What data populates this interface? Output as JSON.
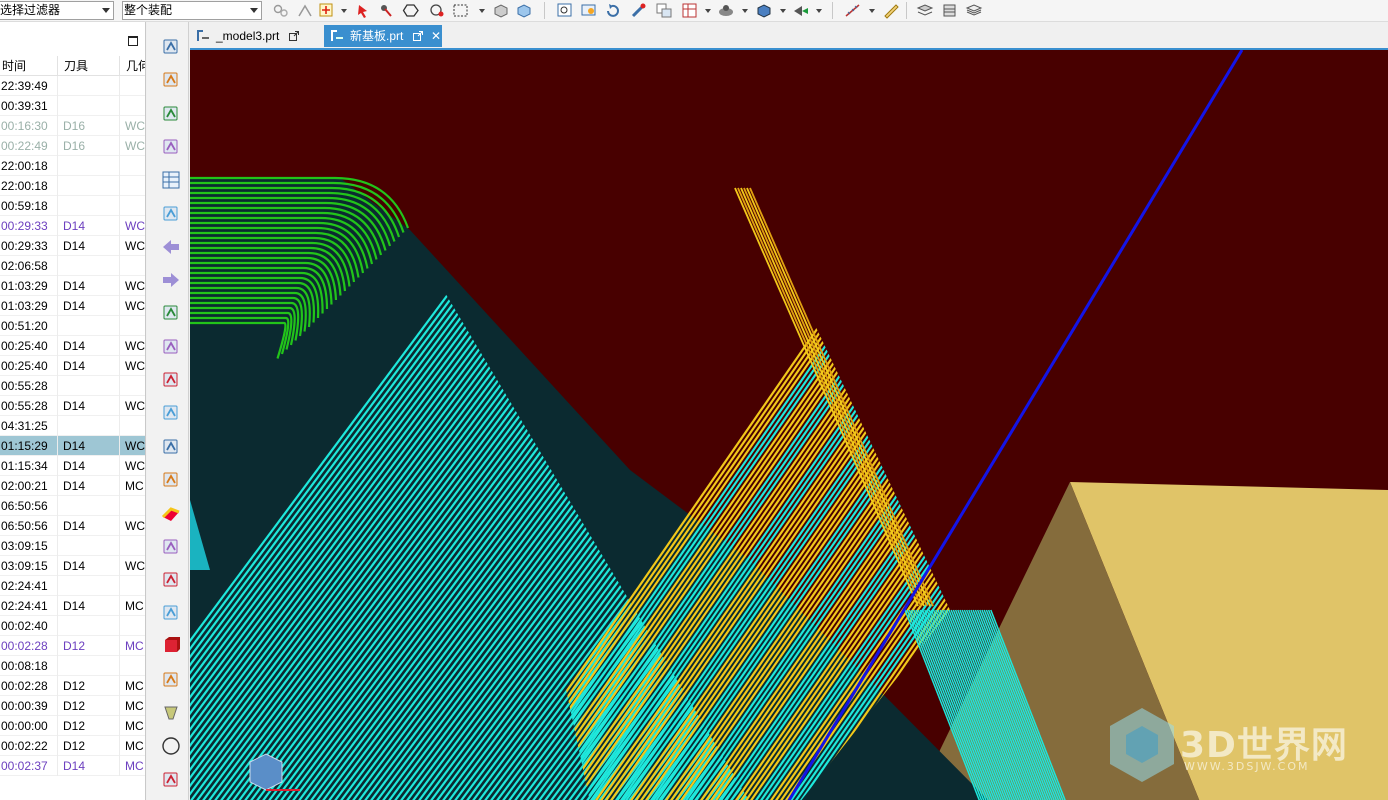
{
  "toolbar": {
    "selection_filter": "选择过滤器",
    "scope": "整个装配"
  },
  "navigator": {
    "columns": [
      "时间",
      "刀具",
      "几何"
    ],
    "rows": [
      {
        "time": "22:39:49",
        "tool": "",
        "geom": "",
        "style": ""
      },
      {
        "time": "00:39:31",
        "tool": "",
        "geom": "",
        "style": ""
      },
      {
        "time": "00:16:30",
        "tool": "D16",
        "geom": "WC",
        "style": "faded"
      },
      {
        "time": "00:22:49",
        "tool": "D16",
        "geom": "WC",
        "style": "faded"
      },
      {
        "time": "22:00:18",
        "tool": "",
        "geom": "",
        "style": ""
      },
      {
        "time": "22:00:18",
        "tool": "",
        "geom": "",
        "style": ""
      },
      {
        "time": "00:59:18",
        "tool": "",
        "geom": "",
        "style": ""
      },
      {
        "time": "00:29:33",
        "tool": "D14",
        "geom": "WC",
        "style": "purple"
      },
      {
        "time": "00:29:33",
        "tool": "D14",
        "geom": "WC",
        "style": ""
      },
      {
        "time": "02:06:58",
        "tool": "",
        "geom": "",
        "style": ""
      },
      {
        "time": "01:03:29",
        "tool": "D14",
        "geom": "WC",
        "style": ""
      },
      {
        "time": "01:03:29",
        "tool": "D14",
        "geom": "WC",
        "style": ""
      },
      {
        "time": "00:51:20",
        "tool": "",
        "geom": "",
        "style": ""
      },
      {
        "time": "00:25:40",
        "tool": "D14",
        "geom": "WC",
        "style": ""
      },
      {
        "time": "00:25:40",
        "tool": "D14",
        "geom": "WC",
        "style": ""
      },
      {
        "time": "00:55:28",
        "tool": "",
        "geom": "",
        "style": ""
      },
      {
        "time": "00:55:28",
        "tool": "D14",
        "geom": "WC",
        "style": ""
      },
      {
        "time": "04:31:25",
        "tool": "",
        "geom": "",
        "style": ""
      },
      {
        "time": "01:15:29",
        "tool": "D14",
        "geom": "WC",
        "style": "sel"
      },
      {
        "time": "01:15:34",
        "tool": "D14",
        "geom": "WC",
        "style": ""
      },
      {
        "time": "02:00:21",
        "tool": "D14",
        "geom": "MC",
        "style": ""
      },
      {
        "time": "06:50:56",
        "tool": "",
        "geom": "",
        "style": ""
      },
      {
        "time": "06:50:56",
        "tool": "D14",
        "geom": "WC",
        "style": ""
      },
      {
        "time": "03:09:15",
        "tool": "",
        "geom": "",
        "style": ""
      },
      {
        "time": "03:09:15",
        "tool": "D14",
        "geom": "WC",
        "style": ""
      },
      {
        "time": "02:24:41",
        "tool": "",
        "geom": "",
        "style": ""
      },
      {
        "time": "02:24:41",
        "tool": "D14",
        "geom": "MC",
        "style": ""
      },
      {
        "time": "00:02:40",
        "tool": "",
        "geom": "",
        "style": ""
      },
      {
        "time": "00:02:28",
        "tool": "D12",
        "geom": "MC",
        "style": "purple"
      },
      {
        "time": "00:08:18",
        "tool": "",
        "geom": "",
        "style": ""
      },
      {
        "time": "00:02:28",
        "tool": "D12",
        "geom": "MC",
        "style": ""
      },
      {
        "time": "00:00:39",
        "tool": "D12",
        "geom": "MC",
        "style": ""
      },
      {
        "time": "00:00:00",
        "tool": "D12",
        "geom": "MC",
        "style": ""
      },
      {
        "time": "00:02:22",
        "tool": "D12",
        "geom": "MC",
        "style": ""
      },
      {
        "time": "00:02:37",
        "tool": "D14",
        "geom": "MC",
        "style": "purple"
      }
    ]
  },
  "tabs": [
    {
      "label": "_model3.prt",
      "active": false
    },
    {
      "label": "新基板.prt",
      "active": true
    }
  ],
  "viewport": {
    "background": "#480000",
    "colors": {
      "finish_pass": "#22c41a",
      "cyan_pass": "#1ee8dc",
      "yellow_pass": "#f2c81a",
      "tool_axis": "#1414e6",
      "part_face": "#e0c468"
    }
  },
  "watermark": {
    "brand": "3D世界网",
    "url": "WWW.3DSJW.COM"
  },
  "icons": {
    "toolbar": [
      "filter-icon",
      "snap-icon",
      "select-icon",
      "cursor-icon",
      "node-icon",
      "hexagon-icon",
      "move-icon",
      "box-select-icon",
      "cube-shaded-icon",
      "cube-icon",
      "fit-icon",
      "zoom-icon",
      "rotate-icon",
      "pan-icon",
      "layer-icon",
      "layout-icon",
      "render-icon",
      "view-cube-icon",
      "view-dir-icon",
      "measure-icon",
      "ruler-icon",
      "stack-icon",
      "layers-icon",
      "layers-alt-icon"
    ],
    "resource_bar": [
      "assembly-nav-icon",
      "constraint-icon",
      "tool-icon",
      "history-icon",
      "table-icon",
      "part-nav-icon",
      "back-icon",
      "forward-icon",
      "drill-icon",
      "feature-icon",
      "machine-icon",
      "program-icon",
      "path-icon",
      "tool-nav-icon",
      "material-icon",
      "simulate-icon",
      "workpiece-icon",
      "geometry-icon",
      "block-icon",
      "grid-icon",
      "cone-icon",
      "circle-icon",
      "role-icon"
    ]
  }
}
